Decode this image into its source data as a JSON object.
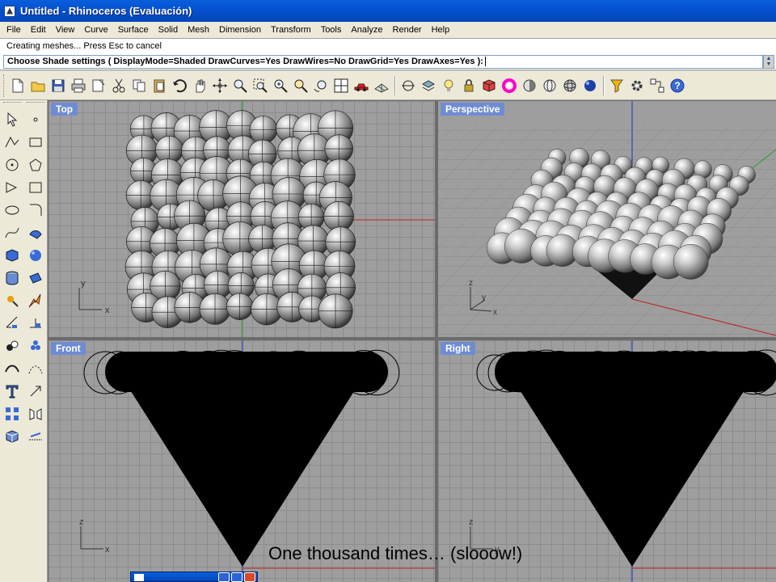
{
  "window": {
    "title": "Untitled - Rhinoceros (Evaluación)"
  },
  "menubar": [
    "File",
    "Edit",
    "View",
    "Curve",
    "Surface",
    "Solid",
    "Mesh",
    "Dimension",
    "Transform",
    "Tools",
    "Analyze",
    "Render",
    "Help"
  ],
  "command": {
    "history": "Creating meshes... Press Esc to cancel",
    "prompt": "Choose Shade settings ( DisplayMode=Shaded  DrawCurves=Yes  DrawWires=No  DrawGrid=Yes  DrawAxes=Yes ):"
  },
  "viewports": {
    "top": {
      "label": "Top",
      "axis_a": "y",
      "axis_b": "x"
    },
    "perspective": {
      "label": "Perspective",
      "axis_a": "z",
      "axis_b": "y",
      "axis_c": "x"
    },
    "front": {
      "label": "Front",
      "axis_a": "z",
      "axis_b": "x"
    },
    "right": {
      "label": "Right",
      "axis_a": "z",
      "axis_b": "y"
    }
  },
  "caption": "One thousand times… (slooow!)",
  "colors": {
    "title_bar": "#0451cf",
    "viewport_label": "#6f8cd3",
    "viewport_bg": "#9e9e9e",
    "axis_x": "#c02020",
    "axis_y": "#20a020",
    "axis_z": "#2030c0"
  }
}
